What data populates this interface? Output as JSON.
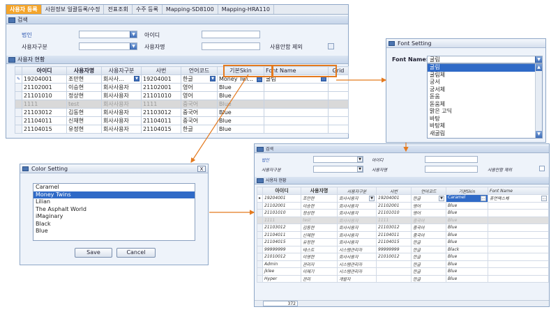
{
  "main_window": {
    "tabs": [
      "사용자 등록",
      "사원정보 일괄등록/수정",
      "전표조회",
      "수주 등록",
      "Mapping-SD8100",
      "Mapping-HRA110"
    ],
    "search_section_title": "검색",
    "search": {
      "corp_label": "법인",
      "id_label": "아이디",
      "user_type_label": "사용자구분",
      "user_name_label": "사용자명",
      "exclude_unused_label": "사용안함 제외"
    },
    "users_section_title": "사용자 현황",
    "grid": {
      "headers": [
        "아이디",
        "사용자명",
        "사용자구분",
        "사번",
        "언어코드",
        "기본Skin",
        "Font Name",
        "Grid"
      ],
      "rows": [
        [
          "19204001",
          "조만현",
          "회사사...",
          "19204001",
          "한글",
          "Money Twi...",
          "굴림"
        ],
        [
          "21102001",
          "이승현",
          "회사사용자",
          "21102001",
          "영어",
          "Blue",
          ""
        ],
        [
          "21101010",
          "정상현",
          "회사사용자",
          "21101010",
          "영어",
          "Blue",
          ""
        ],
        [
          "1111",
          "test",
          "회사사용자",
          "1111",
          "중국어",
          "Blue",
          ""
        ],
        [
          "21103012",
          "김동현",
          "회사사용자",
          "21103012",
          "중국어",
          "Blue",
          ""
        ],
        [
          "21104011",
          "신재현",
          "회사사용자",
          "21104011",
          "중국어",
          "Blue",
          ""
        ],
        [
          "21104015",
          "유정현",
          "회사사용자",
          "21104015",
          "한글",
          "Blue",
          ""
        ]
      ]
    }
  },
  "font_dialog": {
    "title": "Font Setting",
    "font_name_label": "Font Name:",
    "selected_value": "굴림",
    "options": [
      "굴림",
      "굴림체",
      "궁서",
      "궁서체",
      "돋움",
      "돋움체",
      "맑은 고딕",
      "바탕",
      "바탕체",
      "새굴림"
    ]
  },
  "color_dialog": {
    "title": "Color Setting",
    "options": [
      "Caramel",
      "Money Twins",
      "Lilian",
      "The Asphalt World",
      "iMaginary",
      "Black",
      "Blue"
    ],
    "selected_index": 1,
    "save_label": "Save",
    "cancel_label": "Cancel",
    "close_label": "X"
  },
  "result_window": {
    "search_section_title": "검색",
    "search": {
      "corp_label": "법인",
      "id_label": "아이디",
      "user_type_label": "사용자구분",
      "user_name_label": "사용자명",
      "exclude_unused_label": "사용안함 제외"
    },
    "users_section_title": "사용자 현황",
    "grid": {
      "headers": [
        "아이디",
        "사용자명",
        "사용자구분",
        "사번",
        "언어코드",
        "기본Skin",
        "Font Name"
      ],
      "rows": [
        [
          "19204001",
          "조만현",
          "회사사용자",
          "19204001",
          "한글",
          "Caramel",
          "휴먼엑스체"
        ],
        [
          "21102001",
          "이승현",
          "회사사용자",
          "21102001",
          "영어",
          "Blue",
          ""
        ],
        [
          "21101010",
          "정상현",
          "회사사용자",
          "21101010",
          "영어",
          "Blue",
          ""
        ],
        [
          "1111",
          "test",
          "회사사용자",
          "1111",
          "중국어",
          "Blue",
          ""
        ],
        [
          "21103012",
          "김동현",
          "회사사용자",
          "21103012",
          "중국어",
          "Blue",
          ""
        ],
        [
          "21104011",
          "신재현",
          "회사사용자",
          "21104011",
          "중국어",
          "Blue",
          ""
        ],
        [
          "21104015",
          "유정현",
          "회사사용자",
          "21104015",
          "한글",
          "Blue",
          ""
        ],
        [
          "99999999",
          "테스트",
          "시스템관리자",
          "99999999",
          "한글",
          "Black",
          ""
        ],
        [
          "21010012",
          "이영현",
          "회사사용자",
          "21010012",
          "한글",
          "Blue",
          ""
        ],
        [
          "Admin",
          "관리자",
          "시스템관리자",
          "",
          "한글",
          "Blue",
          ""
        ],
        [
          "jklee",
          "이재기",
          "시스템관리자",
          "",
          "한글",
          "Blue",
          ""
        ],
        [
          "Hyper",
          "관리",
          "개발자",
          "",
          "한글",
          "Blue",
          ""
        ]
      ],
      "row_count": "372"
    }
  }
}
